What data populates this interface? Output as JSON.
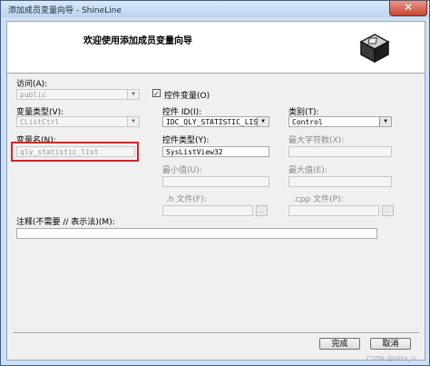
{
  "window": {
    "title": "添加成员变量向导 - ShineLine",
    "close_glyph": "✕"
  },
  "header": {
    "text": "欢迎使用添加成员变量向导",
    "icon": "package-box-icon"
  },
  "form": {
    "access": {
      "label": "访问(A):",
      "value": "public"
    },
    "control_variable": {
      "label": "控件变量(O)",
      "checked": true,
      "check_glyph": "✓"
    },
    "var_type": {
      "label": "变量类型(V):",
      "value": "CListCtrl"
    },
    "control_id": {
      "label": "控件 ID(I):",
      "value": "IDC_QLY_STATISTIC_LIST"
    },
    "category": {
      "label": "类别(T):",
      "value": "Control"
    },
    "var_name": {
      "label": "变量名(N):",
      "value": "qly_statistic_list"
    },
    "control_type": {
      "label": "控件类型(Y):",
      "value": "SysListView32"
    },
    "max_chars": {
      "label": "最大字符数(X):",
      "value": ""
    },
    "min_value": {
      "label": "最小值(U):",
      "value": ""
    },
    "max_value": {
      "label": "最大值(E):",
      "value": ""
    },
    "h_file": {
      "label": ".h 文件(F):",
      "value": "",
      "browse": "..."
    },
    "cpp_file": {
      "label": ".cpp 文件(P):",
      "value": "",
      "browse": "..."
    },
    "comment": {
      "label": "注释(不需要 // 表示法)(M):",
      "value": ""
    }
  },
  "buttons": {
    "finish": "完成",
    "cancel": "取消"
  },
  "dropdown_glyph": "▼",
  "watermark": "CSDN @Vitta_U",
  "colors": {
    "highlight": "#e02020",
    "window_frame": "#cfe0f4",
    "close": "#c8442f"
  }
}
